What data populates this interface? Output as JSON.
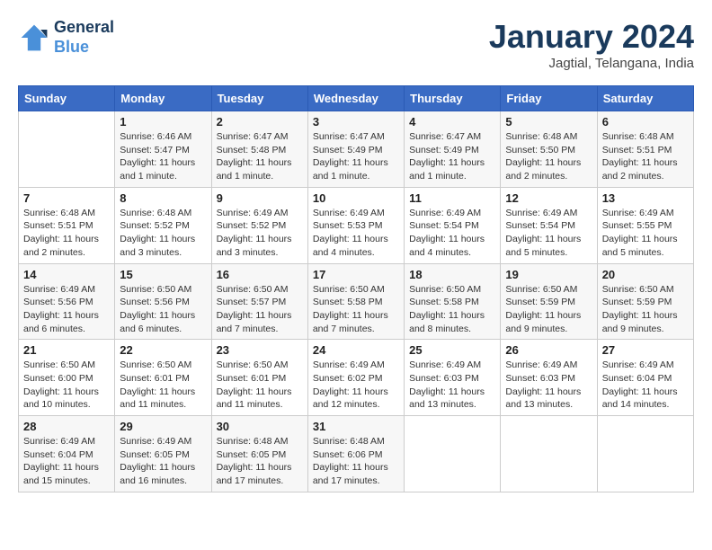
{
  "header": {
    "logo_line1": "General",
    "logo_line2": "Blue",
    "month": "January 2024",
    "location": "Jagtial, Telangana, India"
  },
  "days_of_week": [
    "Sunday",
    "Monday",
    "Tuesday",
    "Wednesday",
    "Thursday",
    "Friday",
    "Saturday"
  ],
  "weeks": [
    [
      {
        "num": "",
        "info": ""
      },
      {
        "num": "1",
        "info": "Sunrise: 6:46 AM\nSunset: 5:47 PM\nDaylight: 11 hours\nand 1 minute."
      },
      {
        "num": "2",
        "info": "Sunrise: 6:47 AM\nSunset: 5:48 PM\nDaylight: 11 hours\nand 1 minute."
      },
      {
        "num": "3",
        "info": "Sunrise: 6:47 AM\nSunset: 5:49 PM\nDaylight: 11 hours\nand 1 minute."
      },
      {
        "num": "4",
        "info": "Sunrise: 6:47 AM\nSunset: 5:49 PM\nDaylight: 11 hours\nand 1 minute."
      },
      {
        "num": "5",
        "info": "Sunrise: 6:48 AM\nSunset: 5:50 PM\nDaylight: 11 hours\nand 2 minutes."
      },
      {
        "num": "6",
        "info": "Sunrise: 6:48 AM\nSunset: 5:51 PM\nDaylight: 11 hours\nand 2 minutes."
      }
    ],
    [
      {
        "num": "7",
        "info": "Sunrise: 6:48 AM\nSunset: 5:51 PM\nDaylight: 11 hours\nand 2 minutes."
      },
      {
        "num": "8",
        "info": "Sunrise: 6:48 AM\nSunset: 5:52 PM\nDaylight: 11 hours\nand 3 minutes."
      },
      {
        "num": "9",
        "info": "Sunrise: 6:49 AM\nSunset: 5:52 PM\nDaylight: 11 hours\nand 3 minutes."
      },
      {
        "num": "10",
        "info": "Sunrise: 6:49 AM\nSunset: 5:53 PM\nDaylight: 11 hours\nand 4 minutes."
      },
      {
        "num": "11",
        "info": "Sunrise: 6:49 AM\nSunset: 5:54 PM\nDaylight: 11 hours\nand 4 minutes."
      },
      {
        "num": "12",
        "info": "Sunrise: 6:49 AM\nSunset: 5:54 PM\nDaylight: 11 hours\nand 5 minutes."
      },
      {
        "num": "13",
        "info": "Sunrise: 6:49 AM\nSunset: 5:55 PM\nDaylight: 11 hours\nand 5 minutes."
      }
    ],
    [
      {
        "num": "14",
        "info": "Sunrise: 6:49 AM\nSunset: 5:56 PM\nDaylight: 11 hours\nand 6 minutes."
      },
      {
        "num": "15",
        "info": "Sunrise: 6:50 AM\nSunset: 5:56 PM\nDaylight: 11 hours\nand 6 minutes."
      },
      {
        "num": "16",
        "info": "Sunrise: 6:50 AM\nSunset: 5:57 PM\nDaylight: 11 hours\nand 7 minutes."
      },
      {
        "num": "17",
        "info": "Sunrise: 6:50 AM\nSunset: 5:58 PM\nDaylight: 11 hours\nand 7 minutes."
      },
      {
        "num": "18",
        "info": "Sunrise: 6:50 AM\nSunset: 5:58 PM\nDaylight: 11 hours\nand 8 minutes."
      },
      {
        "num": "19",
        "info": "Sunrise: 6:50 AM\nSunset: 5:59 PM\nDaylight: 11 hours\nand 9 minutes."
      },
      {
        "num": "20",
        "info": "Sunrise: 6:50 AM\nSunset: 5:59 PM\nDaylight: 11 hours\nand 9 minutes."
      }
    ],
    [
      {
        "num": "21",
        "info": "Sunrise: 6:50 AM\nSunset: 6:00 PM\nDaylight: 11 hours\nand 10 minutes."
      },
      {
        "num": "22",
        "info": "Sunrise: 6:50 AM\nSunset: 6:01 PM\nDaylight: 11 hours\nand 11 minutes."
      },
      {
        "num": "23",
        "info": "Sunrise: 6:50 AM\nSunset: 6:01 PM\nDaylight: 11 hours\nand 11 minutes."
      },
      {
        "num": "24",
        "info": "Sunrise: 6:49 AM\nSunset: 6:02 PM\nDaylight: 11 hours\nand 12 minutes."
      },
      {
        "num": "25",
        "info": "Sunrise: 6:49 AM\nSunset: 6:03 PM\nDaylight: 11 hours\nand 13 minutes."
      },
      {
        "num": "26",
        "info": "Sunrise: 6:49 AM\nSunset: 6:03 PM\nDaylight: 11 hours\nand 13 minutes."
      },
      {
        "num": "27",
        "info": "Sunrise: 6:49 AM\nSunset: 6:04 PM\nDaylight: 11 hours\nand 14 minutes."
      }
    ],
    [
      {
        "num": "28",
        "info": "Sunrise: 6:49 AM\nSunset: 6:04 PM\nDaylight: 11 hours\nand 15 minutes."
      },
      {
        "num": "29",
        "info": "Sunrise: 6:49 AM\nSunset: 6:05 PM\nDaylight: 11 hours\nand 16 minutes."
      },
      {
        "num": "30",
        "info": "Sunrise: 6:48 AM\nSunset: 6:05 PM\nDaylight: 11 hours\nand 17 minutes."
      },
      {
        "num": "31",
        "info": "Sunrise: 6:48 AM\nSunset: 6:06 PM\nDaylight: 11 hours\nand 17 minutes."
      },
      {
        "num": "",
        "info": ""
      },
      {
        "num": "",
        "info": ""
      },
      {
        "num": "",
        "info": ""
      }
    ]
  ]
}
